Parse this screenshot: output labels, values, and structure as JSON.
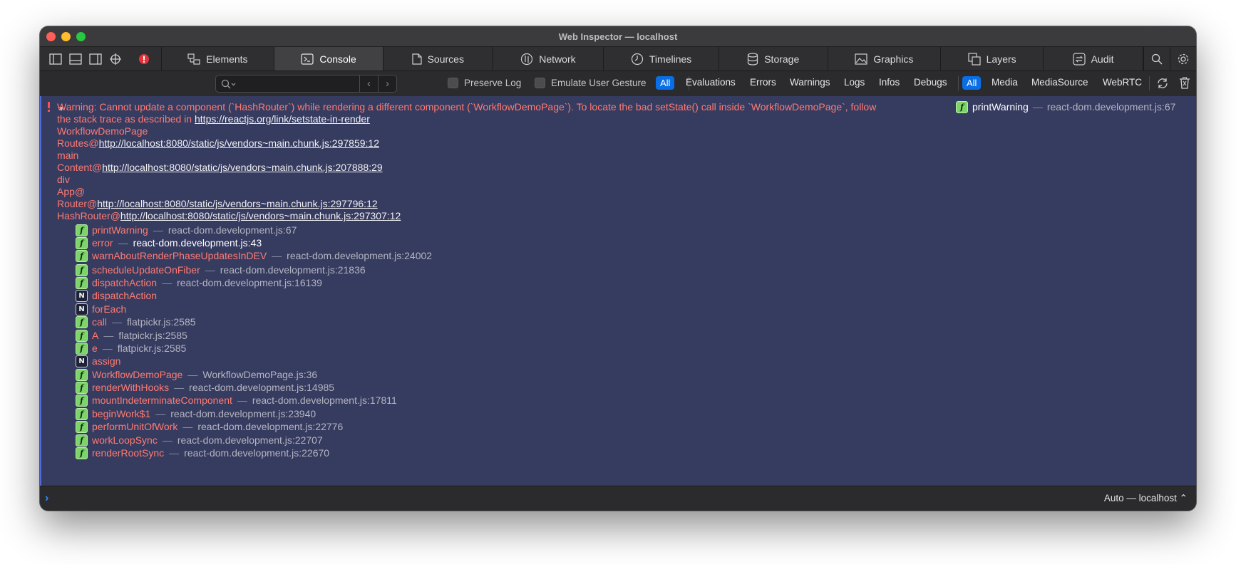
{
  "window": {
    "title": "Web Inspector — localhost"
  },
  "tabs": [
    {
      "label": "Elements",
      "icon": "elements-icon"
    },
    {
      "label": "Console",
      "icon": "console-icon",
      "active": true
    },
    {
      "label": "Sources",
      "icon": "sources-icon"
    },
    {
      "label": "Network",
      "icon": "network-icon"
    },
    {
      "label": "Timelines",
      "icon": "timelines-icon"
    },
    {
      "label": "Storage",
      "icon": "storage-icon"
    },
    {
      "label": "Graphics",
      "icon": "graphics-icon"
    },
    {
      "label": "Layers",
      "icon": "layers-icon"
    },
    {
      "label": "Audit",
      "icon": "audit-icon"
    }
  ],
  "filterbar": {
    "search_placeholder": "",
    "preserve_log": "Preserve Log",
    "emulate_gesture": "Emulate User Gesture",
    "levels": [
      "All",
      "Evaluations",
      "Errors",
      "Warnings",
      "Logs",
      "Infos",
      "Debugs"
    ],
    "sources": [
      "All",
      "Media",
      "MediaSource",
      "WebRTC"
    ]
  },
  "message": {
    "line1": "Warning: Cannot update a component (`HashRouter`) while rendering a different component (`WorkflowDemoPage`). To locate the bad setState() call inside `WorkflowDemoPage`, follow",
    "line2_prefix": "the stack trace as described in ",
    "link": "https://reactjs.org/link/setstate-in-render",
    "source_fn": "printWarning",
    "source_sep": "—",
    "source_loc": "react-dom.development.js:67",
    "component_stack": [
      {
        "name": "WorkflowDemoPage",
        "url": ""
      },
      {
        "name": "Routes@",
        "url": "http://localhost:8080/static/js/vendors~main.chunk.js:297859:12"
      },
      {
        "name": "main",
        "url": ""
      },
      {
        "name": "Content@",
        "url": "http://localhost:8080/static/js/vendors~main.chunk.js:207888:29"
      },
      {
        "name": "div",
        "url": ""
      },
      {
        "name": "App@",
        "url": ""
      },
      {
        "name": "Router@",
        "url": "http://localhost:8080/static/js/vendors~main.chunk.js:297796:12"
      },
      {
        "name": "HashRouter@",
        "url": "http://localhost:8080/static/js/vendors~main.chunk.js:297307:12"
      }
    ],
    "frames": [
      {
        "kind": "f",
        "fn": "printWarning",
        "loc": "react-dom.development.js:67"
      },
      {
        "kind": "f",
        "fn": "error",
        "loc": "react-dom.development.js:43",
        "bright": true
      },
      {
        "kind": "f",
        "fn": "warnAboutRenderPhaseUpdatesInDEV",
        "loc": "react-dom.development.js:24002"
      },
      {
        "kind": "f",
        "fn": "scheduleUpdateOnFiber",
        "loc": "react-dom.development.js:21836"
      },
      {
        "kind": "f",
        "fn": "dispatchAction",
        "loc": "react-dom.development.js:16139"
      },
      {
        "kind": "N",
        "fn": "dispatchAction",
        "loc": ""
      },
      {
        "kind": "N",
        "fn": "forEach",
        "loc": ""
      },
      {
        "kind": "f",
        "fn": "call",
        "loc": "flatpickr.js:2585"
      },
      {
        "kind": "f",
        "fn": "A",
        "loc": "flatpickr.js:2585"
      },
      {
        "kind": "f",
        "fn": "e",
        "loc": "flatpickr.js:2585"
      },
      {
        "kind": "N",
        "fn": "assign",
        "loc": ""
      },
      {
        "kind": "f",
        "fn": "WorkflowDemoPage",
        "loc": "WorkflowDemoPage.js:36"
      },
      {
        "kind": "f",
        "fn": "renderWithHooks",
        "loc": "react-dom.development.js:14985"
      },
      {
        "kind": "f",
        "fn": "mountIndeterminateComponent",
        "loc": "react-dom.development.js:17811"
      },
      {
        "kind": "f",
        "fn": "beginWork$1",
        "loc": "react-dom.development.js:23940"
      },
      {
        "kind": "f",
        "fn": "performUnitOfWork",
        "loc": "react-dom.development.js:22776"
      },
      {
        "kind": "f",
        "fn": "workLoopSync",
        "loc": "react-dom.development.js:22707"
      },
      {
        "kind": "f",
        "fn": "renderRootSync",
        "loc": "react-dom.development.js:22670"
      }
    ]
  },
  "prompt": {
    "context": "Auto — localhost ⌃"
  },
  "colors": {
    "accent": "#0a6fe6",
    "error": "#ff7b72",
    "message_bg": "#363b60"
  }
}
